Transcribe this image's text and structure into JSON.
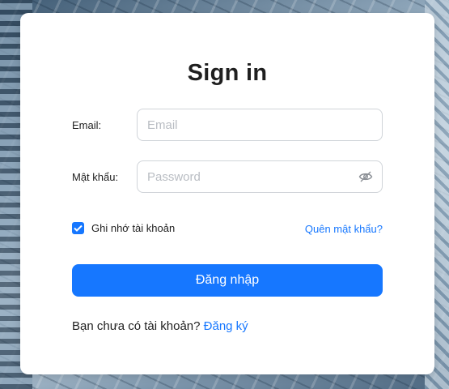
{
  "form": {
    "title": "Sign in",
    "email_label": "Email:",
    "email_placeholder": "Email",
    "email_value": "",
    "password_label": "Mật khẩu:",
    "password_placeholder": "Password",
    "password_value": "",
    "remember_label": "Ghi nhớ tài khoản",
    "remember_checked": true,
    "forgot_label": "Quên mật khẩu?",
    "submit_label": "Đăng nhập",
    "signup_prompt": "Bạn chưa có tài khoản?",
    "signup_link": "Đăng ký"
  },
  "colors": {
    "accent": "#1677ff",
    "text": "#1f1f1f",
    "placeholder": "#b9bdc3",
    "border": "#d0d4d9",
    "card": "#ffffff"
  },
  "icons": {
    "password_toggle": "eye-invisible-icon",
    "checkbox": "check-icon"
  }
}
